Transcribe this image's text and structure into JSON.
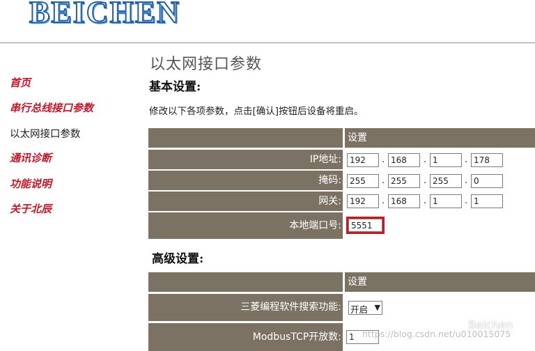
{
  "header": {
    "logo_text": "BEICHEN"
  },
  "sidebar": {
    "items": [
      {
        "label": "首页"
      },
      {
        "label": "串行总线接口参数"
      },
      {
        "label": "以太网接口参数"
      },
      {
        "label": "通讯诊断"
      },
      {
        "label": "功能说明"
      },
      {
        "label": "关于北辰"
      }
    ],
    "current_index": 2
  },
  "main": {
    "page_title": "以太网接口参数",
    "basic": {
      "heading": "基本设置:",
      "note": "修改以下各项参数，点击[确认]按钮后设备将重启。",
      "table_header": "设置",
      "ip": {
        "label": "IP地址:",
        "octets": [
          "192",
          "168",
          "1",
          "178"
        ]
      },
      "mask": {
        "label": "掩码:",
        "octets": [
          "255",
          "255",
          "255",
          "0"
        ]
      },
      "gateway": {
        "label": "网关:",
        "octets": [
          "192",
          "168",
          "1",
          "1"
        ]
      },
      "port": {
        "label": "本地端口号:",
        "value": "5551"
      },
      "separator": "."
    },
    "advanced": {
      "heading": "高级设置:",
      "table_header": "设置",
      "search": {
        "label": "三菱编程软件搜索功能:",
        "value": "开启",
        "arrow": "▼"
      },
      "modbus": {
        "label": "ModbusTCP开放数:",
        "value": "1"
      }
    }
  },
  "watermark": {
    "url": "https://blog.csdn.net/u010015075",
    "brand": "Beichen"
  },
  "colors": {
    "row_bg": "#7c7264",
    "nav_red": "#c0182a",
    "highlight": "#c41a22",
    "logo_blue": "#1f5fa8"
  }
}
